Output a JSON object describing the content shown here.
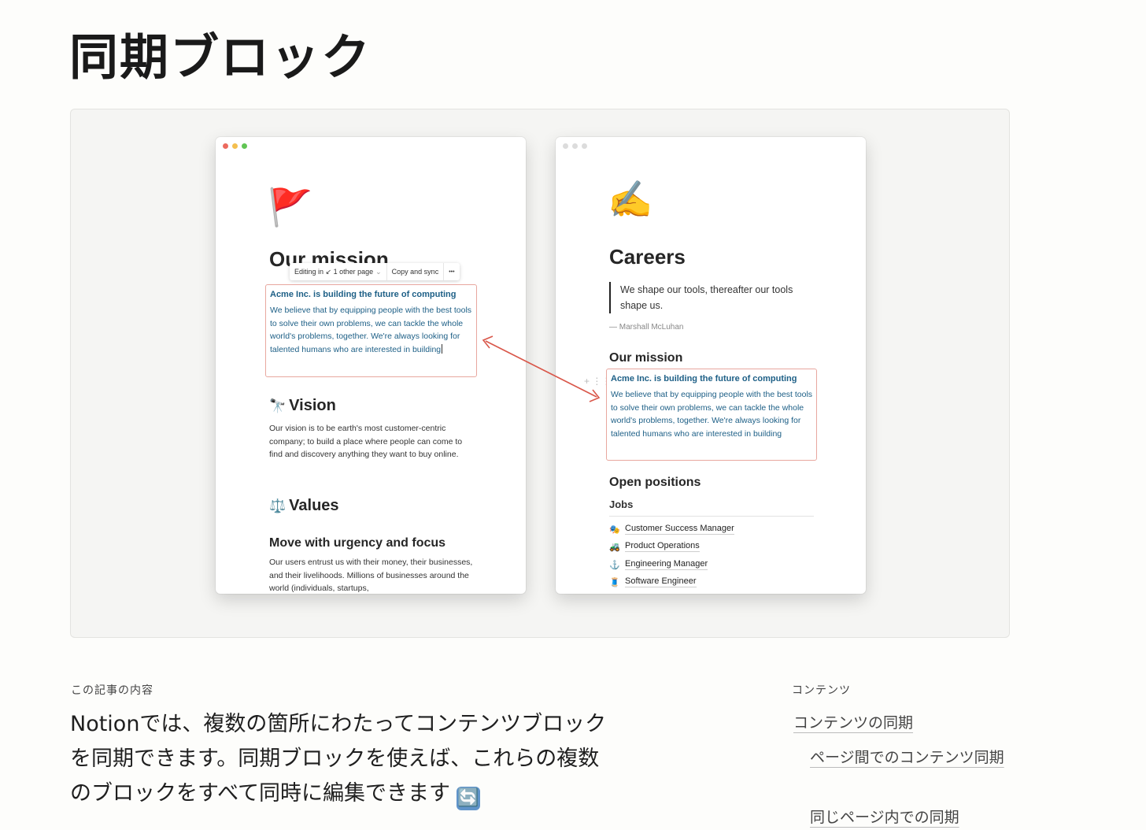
{
  "page": {
    "title": "同期ブロック",
    "intro_label": "この記事の内容",
    "lead": "Notionでは、複数の箇所にわたってコンテンツブロックを同期できます。同期ブロックを使えば、これらの複数のブロックをすべて同時に編集できます",
    "lead_emoji": "🔄"
  },
  "toc": {
    "heading": "コンテンツ",
    "items": [
      "コンテンツの同期",
      "ページ間でのコンテンツ同期",
      "同じページ内での同期"
    ]
  },
  "colors": {
    "sync_border": "#e8a79f",
    "sync_text": "#1d5f86",
    "arrow": "#d9574a",
    "dot_red": "#ec6a5e",
    "dot_yellow": "#f4bf4f",
    "dot_green": "#61c554",
    "dot_gray": "#dcdcdc"
  },
  "left_window": {
    "page_icon": "🚩",
    "title": "Our mission",
    "toolbar": {
      "editing": "Editing in ↙ 1 other page",
      "caret": "⌄",
      "copy_sync": "Copy and sync",
      "more": "•••"
    },
    "sync_block": {
      "title": "Acme Inc. is building the future of computing",
      "body": "We believe that by equipping people with the best tools to solve their own problems, we can tackle the whole world's problems, together. We're always looking for talented humans who are interested in building"
    },
    "vision_icon": "🔭",
    "vision_title": "Vision",
    "vision_body": "Our vision is to be earth's most customer-centric company; to build a place where people can come to find and discovery anything they want to buy online.",
    "values_icon": "⚖️",
    "values_title": "Values",
    "urgency_title": "Move with urgency and focus",
    "urgency_body": "Our users entrust us with their money, their businesses, and their livelihoods. Millions of businesses around the world (individuals, startups,"
  },
  "right_window": {
    "page_icon": "✍️",
    "title": "Careers",
    "quote": "We shape our tools, thereafter our tools shape us.",
    "quote_author": "— Marshall McLuhan",
    "mission_title": "Our mission",
    "handle": "+ ⋮⋮",
    "sync_block": {
      "title": "Acme Inc. is building the future of computing",
      "body": "We believe that by equipping people with the best tools to solve their own problems, we can tackle the whole world's problems, together. We're always looking for talented humans who are interested in building"
    },
    "open_positions": "Open positions",
    "jobs_heading": "Jobs",
    "jobs": [
      {
        "icon": "🎭",
        "label": "Customer Success Manager"
      },
      {
        "icon": "🚜",
        "label": "Product Operations"
      },
      {
        "icon": "⚓",
        "label": "Engineering Manager"
      },
      {
        "icon": "🧵",
        "label": "Software Engineer"
      }
    ]
  }
}
